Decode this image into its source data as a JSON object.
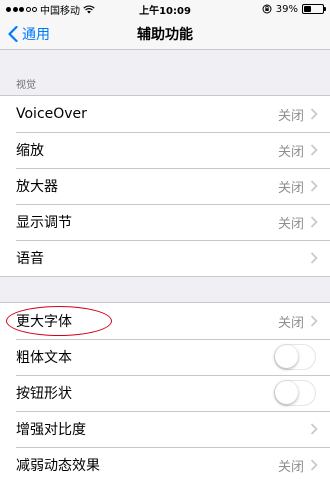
{
  "status_bar": {
    "carrier": "中国移动",
    "time": "上午10:09",
    "battery_percent": "39%",
    "battery_level": 0.39,
    "signal_bars": 3
  },
  "nav": {
    "back_label": "通用",
    "title": "辅助功能"
  },
  "section_vision": {
    "header": "视觉",
    "rows": [
      {
        "label": "VoiceOver",
        "value": "关闭"
      },
      {
        "label": "缩放",
        "value": "关闭"
      },
      {
        "label": "放大器",
        "value": "关闭"
      },
      {
        "label": "显示调节",
        "value": "关闭"
      },
      {
        "label": "语音",
        "value": ""
      }
    ]
  },
  "section_text": {
    "rows": [
      {
        "label": "更大字体",
        "value": "关闭",
        "type": "chevron"
      },
      {
        "label": "粗体文本",
        "type": "toggle",
        "on": false
      },
      {
        "label": "按钮形状",
        "type": "toggle",
        "on": false
      },
      {
        "label": "增强对比度",
        "value": "",
        "type": "chevron"
      },
      {
        "label": "减弱动态效果",
        "value": "关闭",
        "type": "chevron"
      }
    ]
  },
  "colors": {
    "accent": "#007aff",
    "annotation": "#d0021b",
    "background": "#efeff4"
  }
}
